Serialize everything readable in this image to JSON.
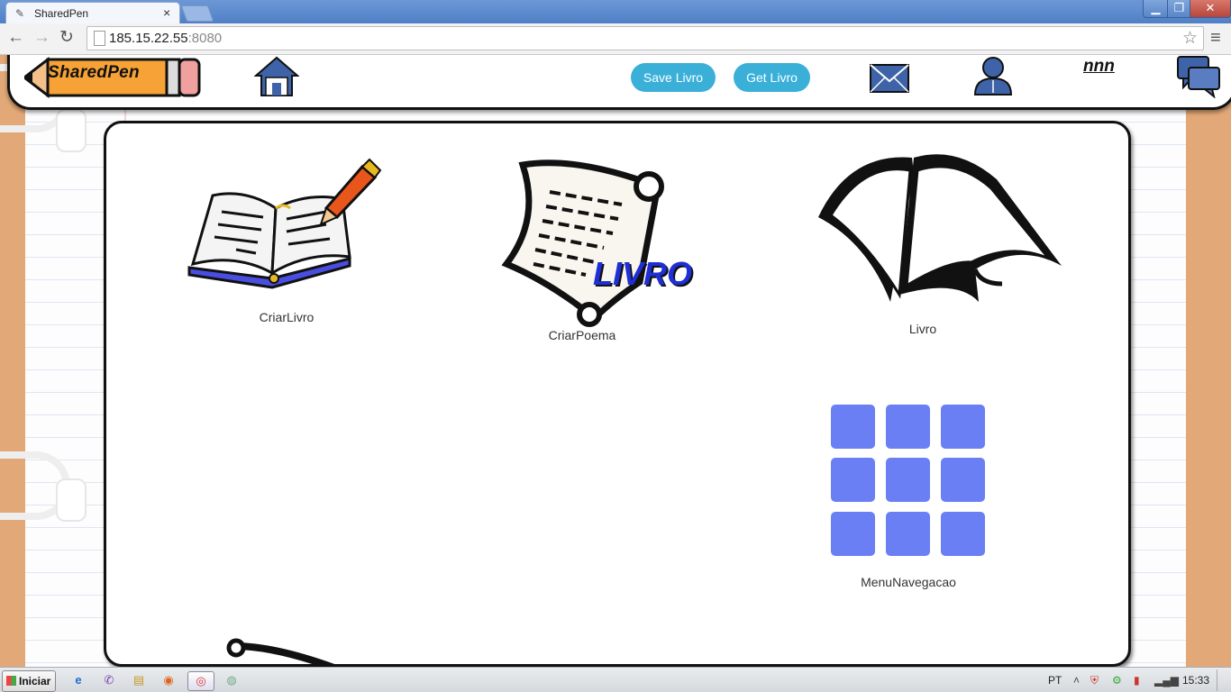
{
  "browser": {
    "tab_title": "SharedPen",
    "tab_close": "×",
    "url_host": "185.15.22.55",
    "url_port": ":8080",
    "window_controls": {
      "minimize": "▁",
      "maximize": "❐",
      "close": "✕"
    },
    "nav": {
      "back": "←",
      "forward": "→",
      "reload": "↻",
      "star": "☆",
      "menu": "≡"
    }
  },
  "header": {
    "logo_text": "SharedPen",
    "save_button": "Save Livro",
    "get_button": "Get Livro",
    "username": "nnn"
  },
  "cards": [
    {
      "label": "CriarLivro",
      "icon": "open-book-pencil-icon"
    },
    {
      "label": "CriarPoema",
      "icon": "scroll-icon",
      "overlay_text": "LIVRO"
    },
    {
      "label": "Livro",
      "icon": "open-book-icon"
    },
    {
      "label": "MenuNavegacao",
      "icon": "grid-menu-icon"
    }
  ],
  "taskbar": {
    "start_label": "Iniciar",
    "language": "PT",
    "clock": "15:33",
    "tray_arrow": "˄"
  },
  "colors": {
    "accent_button": "#3ab0d8",
    "grid_tile": "#6b7ff5",
    "page_background": "#e2a877",
    "livro_text": "#1f2fd6"
  }
}
